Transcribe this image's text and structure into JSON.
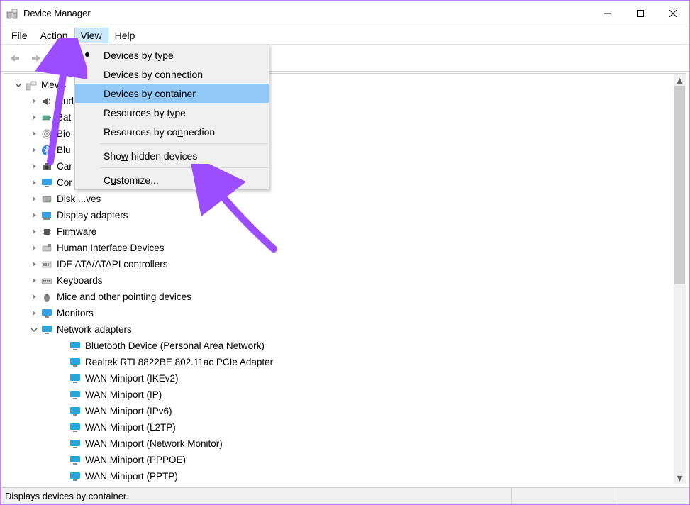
{
  "window": {
    "title": "Device Manager"
  },
  "menubar": {
    "file": "File",
    "action": "Action",
    "view": "View",
    "help": "Help"
  },
  "dropdown": {
    "devices_by_type": "Devices by type",
    "devices_by_connection": "Devices by connection",
    "devices_by_container": "Devices by container",
    "resources_by_type": "Resources by type",
    "resources_by_connection": "Resources by connection",
    "show_hidden": "Show hidden devices",
    "customize": "Customize..."
  },
  "tree": {
    "root": "Mevis",
    "cat": {
      "audio": "Aud",
      "batteries": "Bat",
      "biometric": "Bio",
      "bluetooth": "Blu",
      "cameras": "Car",
      "computer": "Cor",
      "disk": "Disk ...ves",
      "display": "Display adapters",
      "firmware": "Firmware",
      "hid": "Human Interface Devices",
      "ide": "IDE ATA/ATAPI controllers",
      "keyboards": "Keyboards",
      "mice": "Mice and other pointing devices",
      "monitors": "Monitors",
      "network": "Network adapters"
    },
    "net": {
      "0": "Bluetooth Device (Personal Area Network)",
      "1": "Realtek RTL8822BE 802.11ac PCIe Adapter",
      "2": "WAN Miniport (IKEv2)",
      "3": "WAN Miniport (IP)",
      "4": "WAN Miniport (IPv6)",
      "5": "WAN Miniport (L2TP)",
      "6": "WAN Miniport (Network Monitor)",
      "7": "WAN Miniport (PPPOE)",
      "8": "WAN Miniport (PPTP)"
    }
  },
  "statusbar": {
    "text": "Displays devices by container."
  }
}
